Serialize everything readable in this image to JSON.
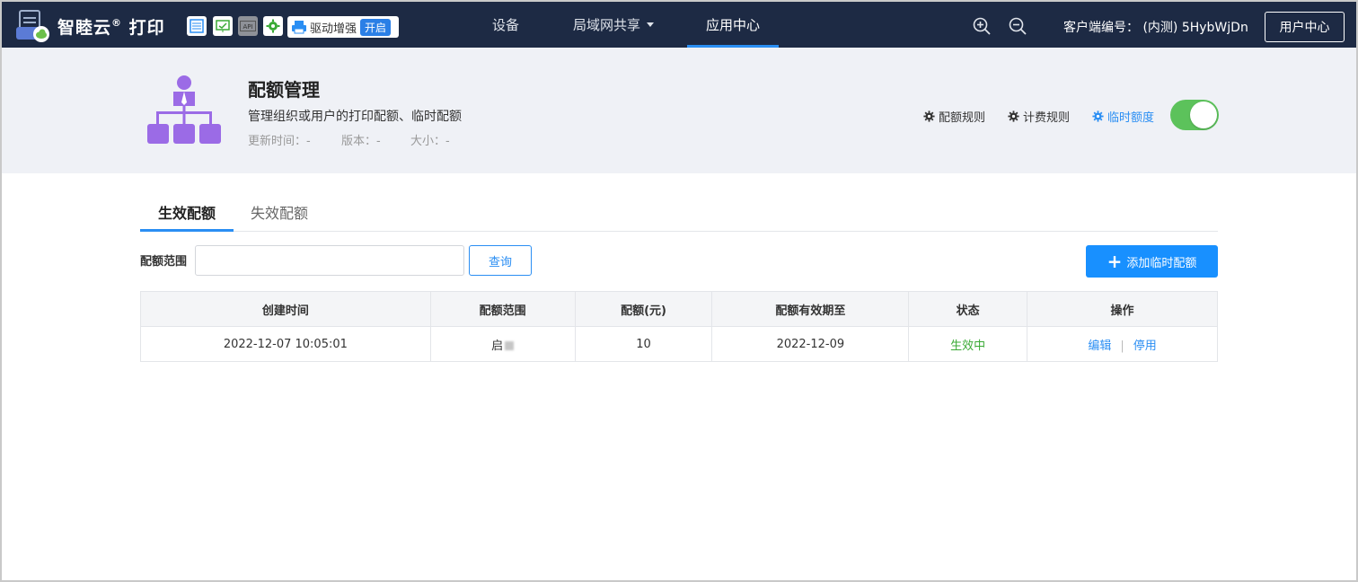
{
  "app": {
    "brand": "智睦云",
    "brand_mark": "®",
    "brand_suffix": "打印",
    "driver_label": "驱动增强",
    "driver_state": "开启",
    "nav": [
      {
        "label": "设备"
      },
      {
        "label": "局域网共享"
      },
      {
        "label": "应用中心"
      }
    ],
    "client_id_label": "客户端编号：",
    "client_id_value": "(内测) 5HybWjDn",
    "user_center": "用户中心",
    "accent": "#2a8ef3",
    "topbar_bg": "#1d2a44"
  },
  "tool_icons": [
    "list-icon",
    "monitor-icon",
    "api-icon",
    "gear-icon"
  ],
  "hero": {
    "title": "配额管理",
    "description": "管理组织或用户的打印配额、临时配额",
    "updated": "更新时间：-",
    "version": "版本：-",
    "size": "大小：-",
    "rules": [
      "配额规则",
      "计费规则",
      "临时额度"
    ],
    "temp_quota_enabled": true,
    "icon_color": "#9b6be6"
  },
  "tabs": [
    {
      "label": "生效配额",
      "active": true
    },
    {
      "label": "失效配额",
      "active": false
    }
  ],
  "filter": {
    "label": "配额范围",
    "value": "",
    "query_button": "查询",
    "add_button": "添加临时配额"
  },
  "table": {
    "headers": [
      "创建时间",
      "配额范围",
      "配额(元)",
      "配额有效期至",
      "状态",
      "操作"
    ],
    "rows": [
      {
        "created": "2022-12-07 10:05:01",
        "scope": "启",
        "amount": "10",
        "expires": "2022-12-09",
        "status": "生效中",
        "actions": [
          "编辑",
          "停用"
        ]
      }
    ]
  }
}
